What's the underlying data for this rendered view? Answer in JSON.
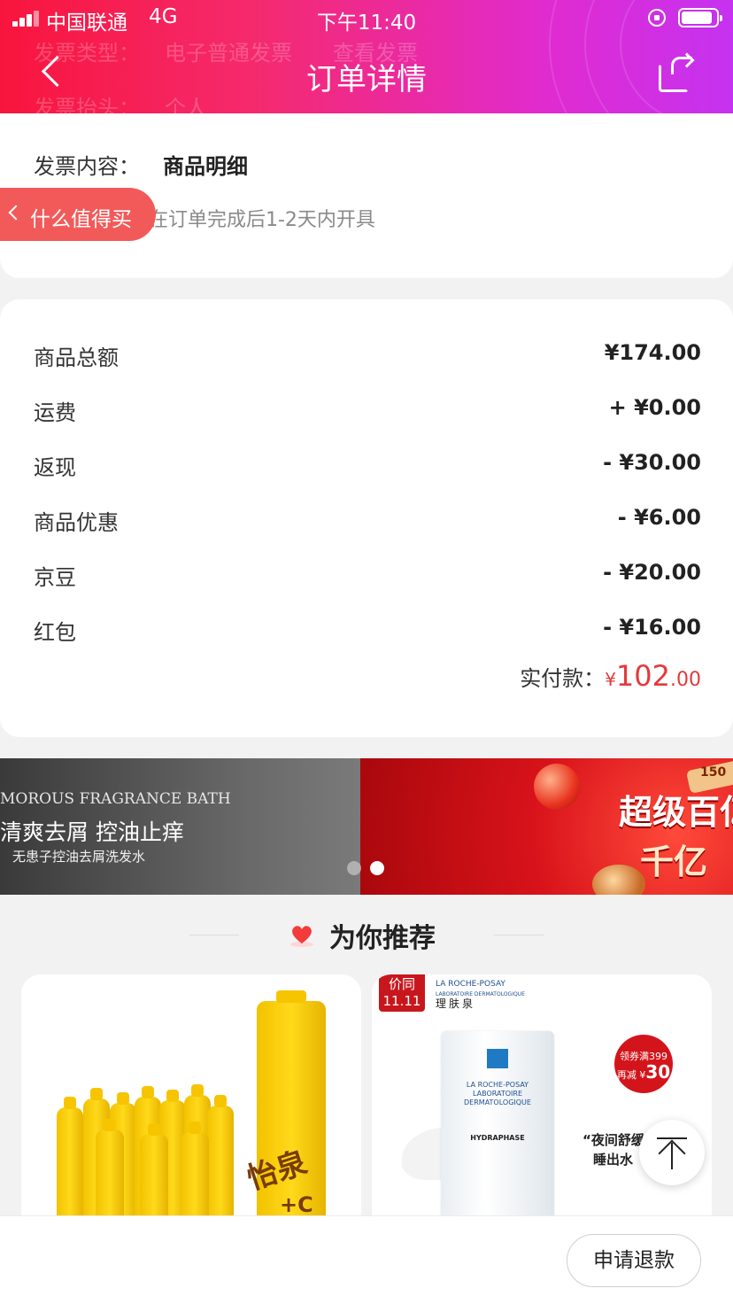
{
  "status_bar": {
    "carrier": "中国联通",
    "network": "4G",
    "time": "下午11:40"
  },
  "header": {
    "title": "订单详情",
    "ghost_row_1": [
      "发票类型：",
      "电子普通发票",
      "查看发票"
    ],
    "ghost_row_2": [
      "发票抬头：",
      "个人"
    ]
  },
  "invoice": {
    "content_label": "发票内容：",
    "content_value": "商品明细",
    "note": "将在订单完成后1-2天内开具"
  },
  "floating_tab": {
    "label": "什么值得买"
  },
  "price_summary": {
    "rows": [
      {
        "label": "商品总额",
        "value": "¥174.00"
      },
      {
        "label": "运费",
        "value": "+ ¥0.00"
      },
      {
        "label": "返现",
        "value": "- ¥30.00"
      },
      {
        "label": "商品优惠",
        "value": "- ¥6.00"
      },
      {
        "label": "京豆",
        "value": "- ¥20.00"
      },
      {
        "label": "红包",
        "value": "- ¥16.00"
      }
    ],
    "paid_label": "实付款：",
    "paid_currency": "¥",
    "paid_integer": "102",
    "paid_decimal": ".00"
  },
  "banner": {
    "left_line1": "MOROUS FRAGRANCE BATH",
    "left_line2": "清爽去屑 控油止痒",
    "left_line3": "无患子控油去屑洗发水",
    "right_line1": "超级百亿",
    "right_line2": "千亿",
    "right_badge": "150",
    "active_dot": 2
  },
  "recommend": {
    "title": "为你推荐"
  },
  "products": [
    {
      "name": "怡泉",
      "badge": "+C"
    },
    {
      "tag_line1": "价同",
      "tag_line2": "11.11",
      "brand_en": "LA ROCHE-POSAY",
      "brand_sub": "LABORATOIRE DERMATOLOGIQUE",
      "brand_cn": "理肤泉",
      "tube_brand": "LA ROCHE-POSAY LABORATOIRE DERMATOLOGIQUE",
      "tube_name": "HYDRAPHASE",
      "coupon_line1": "领券满399",
      "coupon_line2": "再减 ¥",
      "coupon_amount": "30",
      "slogan_line1": "“夜间舒缓",
      "slogan_line2": "睡出水"
    }
  ],
  "bottom": {
    "refund_button": "申请退款"
  },
  "colors": {
    "accent_red": "#e4393c",
    "header_start": "#f8153d",
    "header_end": "#c532f0"
  }
}
